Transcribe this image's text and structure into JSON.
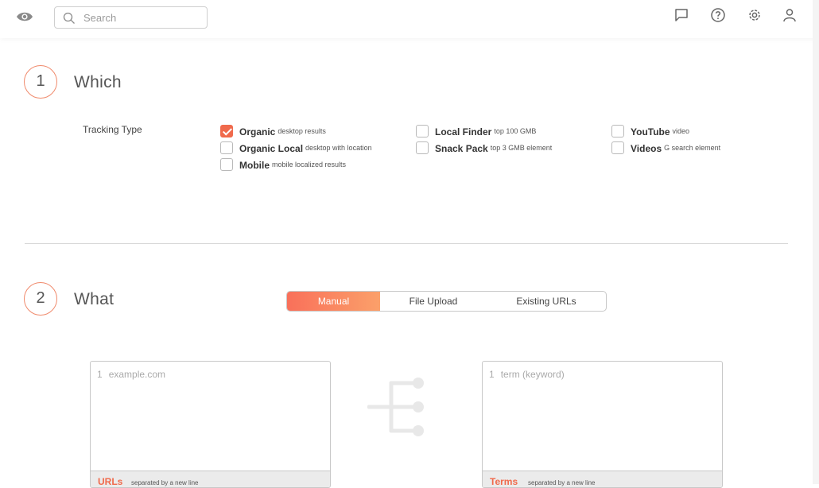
{
  "topbar": {
    "search_placeholder": "Search",
    "icons": [
      "eye-icon",
      "search-icon",
      "chat-icon",
      "help-icon",
      "settings-icon",
      "user-icon"
    ]
  },
  "step1": {
    "number": "1",
    "title": "Which",
    "tracking_label": "Tracking Type",
    "options": [
      {
        "name": "Organic",
        "desc": "desktop results",
        "checked": true
      },
      {
        "name": "Organic Local",
        "desc": "desktop with location",
        "checked": false
      },
      {
        "name": "Mobile",
        "desc": "mobile localized results",
        "checked": false
      },
      {
        "name": "Local Finder",
        "desc": "top 100 GMB",
        "checked": false
      },
      {
        "name": "Snack Pack",
        "desc": "top 3 GMB element",
        "checked": false
      },
      {
        "name": "YouTube",
        "desc": "video",
        "checked": false
      },
      {
        "name": "Videos",
        "desc": "G search element",
        "checked": false
      }
    ]
  },
  "step2": {
    "number": "2",
    "title": "What",
    "tabs": [
      {
        "label": "Manual",
        "active": true
      },
      {
        "label": "File Upload",
        "active": false
      },
      {
        "label": "Existing URLs",
        "active": false
      }
    ],
    "urls": {
      "line_no": "1",
      "placeholder": "example.com",
      "label": "URLs",
      "hint": "separated by a new line"
    },
    "terms": {
      "line_no": "1",
      "placeholder": "term (keyword)",
      "label": "Terms",
      "hint": "separated by a new line"
    }
  },
  "colors": {
    "accent": "#f06a4c",
    "accent_light": "#fba06a"
  }
}
